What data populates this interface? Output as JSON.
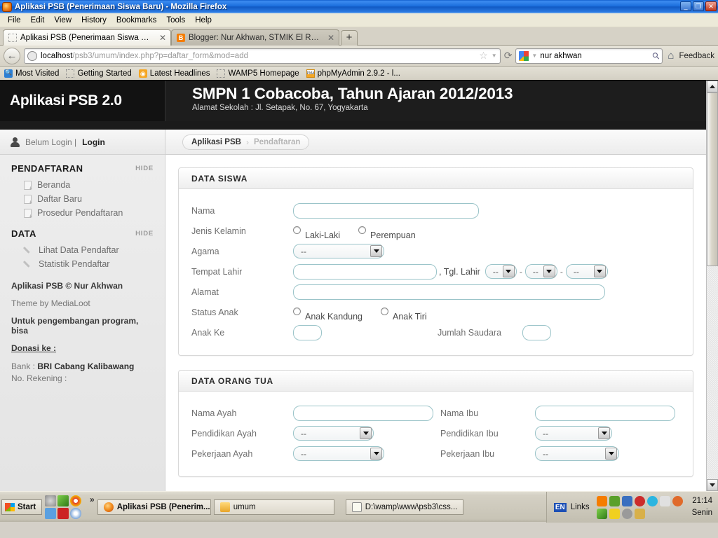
{
  "window": {
    "title": "Aplikasi PSB (Penerimaan Siswa Baru) - Mozilla Firefox",
    "minimize": "_",
    "restore": "❐",
    "close": "✕"
  },
  "menubar": [
    "File",
    "Edit",
    "View",
    "History",
    "Bookmarks",
    "Tools",
    "Help"
  ],
  "tabs": [
    {
      "label": "Aplikasi PSB (Penerimaan Siswa Baru)",
      "close": "✕",
      "active": true
    },
    {
      "label": "Blogger: Nur Akhwan, STMIK El Rahma Y...",
      "close": "✕",
      "active": false
    }
  ],
  "newtab_label": "+",
  "urlbar": {
    "back": "←",
    "host": "localhost",
    "path": "/psb3/umum/index.php?p=daftar_form&mod=add",
    "star": "☆",
    "caret": "▼",
    "reload": "⟳"
  },
  "searchbar": {
    "value": "nur akhwan",
    "magnifier": "⚲"
  },
  "toolbar_right": {
    "home": "⌂",
    "feedback": "Feedback"
  },
  "bookmarks": [
    {
      "label": "Most Visited",
      "icon": "search-icon"
    },
    {
      "label": "Getting Started",
      "icon": "dotted-icon"
    },
    {
      "label": "Latest Headlines",
      "icon": "rss-icon"
    },
    {
      "label": "WAMP5 Homepage",
      "icon": "dotted-icon"
    },
    {
      "label": "phpMyAdmin 2.9.2 - l...",
      "icon": "pma-icon"
    }
  ],
  "site": {
    "brand": "Aplikasi PSB 2.0",
    "school_name": "SMPN 1 Cobacoba, Tahun Ajaran 2012/2013",
    "school_address": "Alamat Sekolah : Jl. Setapak, No. 67, Yogyakarta"
  },
  "loginbar": {
    "status": "Belum Login |",
    "login_link": "Login"
  },
  "sidebar": {
    "sections": [
      {
        "title": "PENDAFTARAN",
        "hide": "HIDE",
        "items": [
          {
            "label": "Beranda",
            "icon": "document-add-icon"
          },
          {
            "label": "Daftar Baru",
            "icon": "document-add-icon"
          },
          {
            "label": "Prosedur Pendaftaran",
            "icon": "document-add-icon"
          }
        ]
      },
      {
        "title": "DATA",
        "hide": "HIDE",
        "items": [
          {
            "label": "Lihat Data Pendaftar",
            "icon": "pencil-icon"
          },
          {
            "label": "Statistik Pendaftar",
            "icon": "pencil-icon"
          }
        ]
      }
    ],
    "footer": {
      "copyright": "Aplikasi PSB © Nur Akhwan",
      "theme": "Theme by MediaLoot",
      "dev_note": "Untuk pengembangan program, bisa",
      "donate_heading": "Donasi ke :",
      "bank_label": "Bank : ",
      "bank_name": "BRI Cabang Kalibawang",
      "account": "No. Rekening :"
    }
  },
  "breadcrumb": {
    "root": "Aplikasi PSB",
    "separator": "›",
    "current": "Pendaftaran"
  },
  "form": {
    "section_siswa": {
      "title": "DATA SISWA",
      "nama_label": "Nama",
      "nama_value": "",
      "jk_label": "Jenis Kelamin",
      "jk_options": [
        "Laki-Laki",
        "Perempuan"
      ],
      "agama_label": "Agama",
      "agama_value": "--",
      "tempat_label": "Tempat Lahir",
      "tempat_value": "",
      "tgl_label": ", Tgl. Lahir",
      "tgl_day": "--",
      "tgl_month": "--",
      "tgl_year": "--",
      "date_sep": "-",
      "alamat_label": "Alamat",
      "alamat_value": "",
      "status_label": "Status Anak",
      "status_options": [
        "Anak Kandung",
        "Anak Tiri"
      ],
      "anakke_label": "Anak Ke",
      "anakke_value": "",
      "saudara_label": "Jumlah Saudara",
      "saudara_value": ""
    },
    "section_ortu": {
      "title": "DATA ORANG TUA",
      "ayah_nama_label": "Nama Ayah",
      "ayah_nama_value": "",
      "ibu_nama_label": "Nama Ibu",
      "ibu_nama_value": "",
      "ayah_pend_label": "Pendidikan Ayah",
      "ayah_pend_value": "--",
      "ibu_pend_label": "Pendidikan Ibu",
      "ibu_pend_value": "--",
      "ayah_kerja_label": "Pekerjaan Ayah",
      "ayah_kerja_value": "--",
      "ibu_kerja_label": "Pekerjaan Ibu",
      "ibu_kerja_value": "--"
    }
  },
  "taskbar": {
    "start": "Start",
    "overflow": "»",
    "buttons": [
      {
        "label": "Aplikasi PSB (Penerim...",
        "icon": "firefox-icon"
      },
      {
        "label": "umum",
        "icon": "folder-icon"
      },
      {
        "label": "D:\\wamp\\www\\psb3\\css...",
        "icon": "notepad-icon"
      }
    ],
    "lang": "EN",
    "links": "Links",
    "time": "21:14",
    "day": "Senin"
  },
  "colors": {
    "header_black": "#1b1b1b",
    "field_border": "#9bc4c9",
    "titlebar_blue": "#1c6fdd",
    "sidebar_bg": "#e8e8e8"
  }
}
